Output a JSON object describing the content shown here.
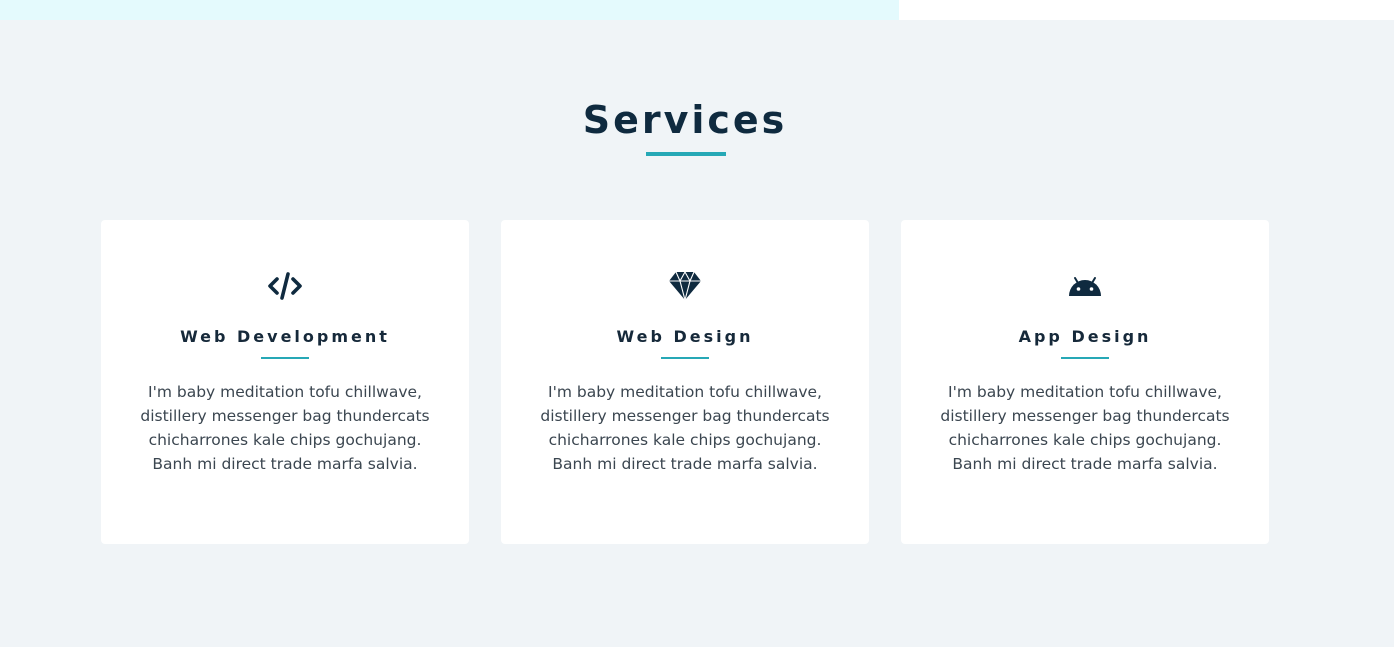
{
  "section": {
    "title": "Services"
  },
  "colors": {
    "background": "#f0f4f7",
    "card": "#ffffff",
    "heading": "#0f2a3f",
    "accent": "#26a8b6",
    "body_text": "#3b4650",
    "top_strip_tint": "#e4fafd"
  },
  "services": [
    {
      "icon": "code-icon",
      "title": "Web Development",
      "description": "I'm baby meditation tofu chillwave, distillery messenger bag thundercats chicharrones kale chips gochujang. Banh mi direct trade marfa salvia."
    },
    {
      "icon": "diamond-icon",
      "title": "Web Design",
      "description": "I'm baby meditation tofu chillwave, distillery messenger bag thundercats chicharrones kale chips gochujang. Banh mi direct trade marfa salvia."
    },
    {
      "icon": "android-icon",
      "title": "App Design",
      "description": "I'm baby meditation tofu chillwave, distillery messenger bag thundercats chicharrones kale chips gochujang. Banh mi direct trade marfa salvia."
    }
  ]
}
